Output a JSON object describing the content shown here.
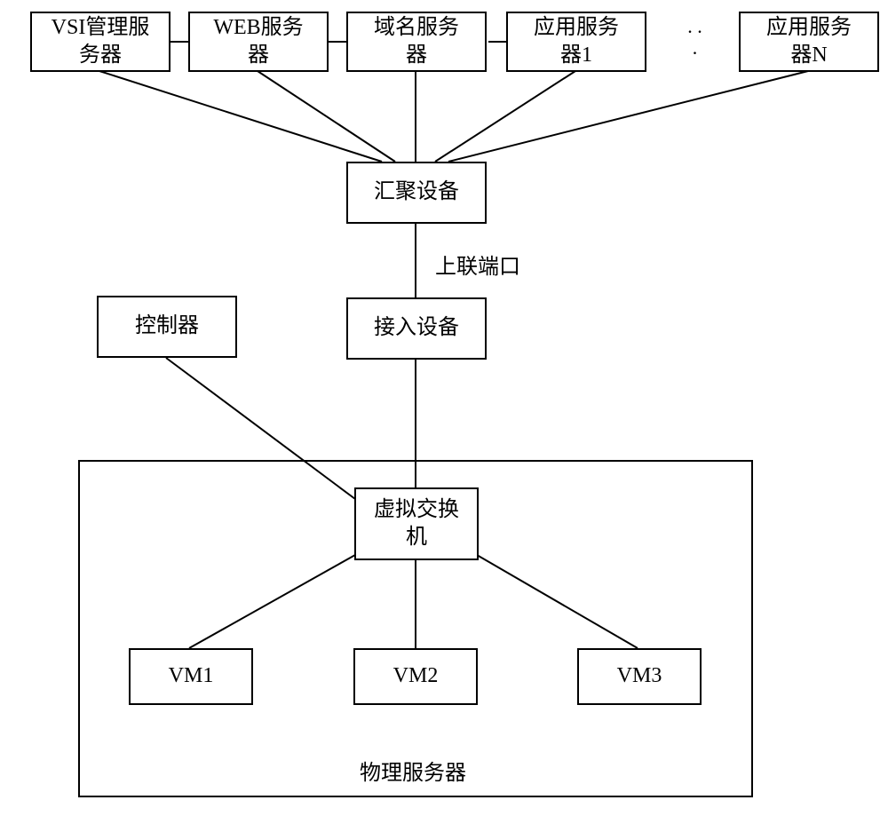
{
  "top_row": {
    "vsi_server": "VSI管理服\n务器",
    "web_server": "WEB服务\n器",
    "dns_server": "域名服务\n器",
    "app_server_1": "应用服务\n器1",
    "app_server_n": "应用服务\n器N",
    "ellipsis": ". .\n."
  },
  "middle": {
    "aggregation_device": "汇聚设备",
    "uplink_port": "上联端口",
    "access_device": "接入设备",
    "controller": "控制器"
  },
  "physical": {
    "virtual_switch": "虚拟交换\n机",
    "vm1": "VM1",
    "vm2": "VM2",
    "vm3": "VM3",
    "physical_server": "物理服务器"
  }
}
